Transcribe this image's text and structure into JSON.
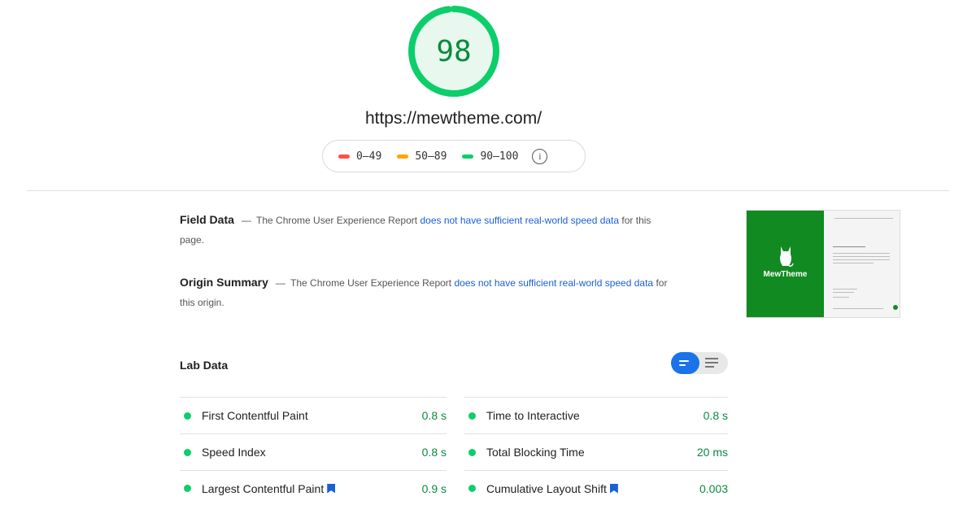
{
  "score": {
    "value": "98",
    "fraction": 0.98,
    "color": "#0cce6b",
    "fill": "#e8f8ee"
  },
  "url": "https://mewtheme.com/",
  "legend": [
    {
      "label": "0–49",
      "color": "#ff4e42"
    },
    {
      "label": "50–89",
      "color": "#ffa400"
    },
    {
      "label": "90–100",
      "color": "#0cce6b"
    }
  ],
  "field_data": {
    "heading": "Field Data",
    "dash": "—",
    "prefix": "The Chrome User Experience Report",
    "link": "does not have sufficient real-world speed data",
    "suffix": "for this page."
  },
  "origin_summary": {
    "heading": "Origin Summary",
    "dash": "—",
    "prefix": "The Chrome User Experience Report",
    "link": "does not have sufficient real-world speed data",
    "suffix": "for this origin."
  },
  "thumbnail": {
    "logo_text": "MewTheme",
    "brand_color": "#128a22"
  },
  "lab_data": {
    "title": "Lab Data",
    "left": [
      {
        "label": "First Contentful Paint",
        "value": "0.8 s",
        "flag": false
      },
      {
        "label": "Speed Index",
        "value": "0.8 s",
        "flag": false
      },
      {
        "label": "Largest Contentful Paint",
        "value": "0.9 s",
        "flag": true
      }
    ],
    "right": [
      {
        "label": "Time to Interactive",
        "value": "0.8 s",
        "flag": false
      },
      {
        "label": "Total Blocking Time",
        "value": "20 ms",
        "flag": false
      },
      {
        "label": "Cumulative Layout Shift",
        "value": "0.003",
        "flag": true
      }
    ]
  }
}
